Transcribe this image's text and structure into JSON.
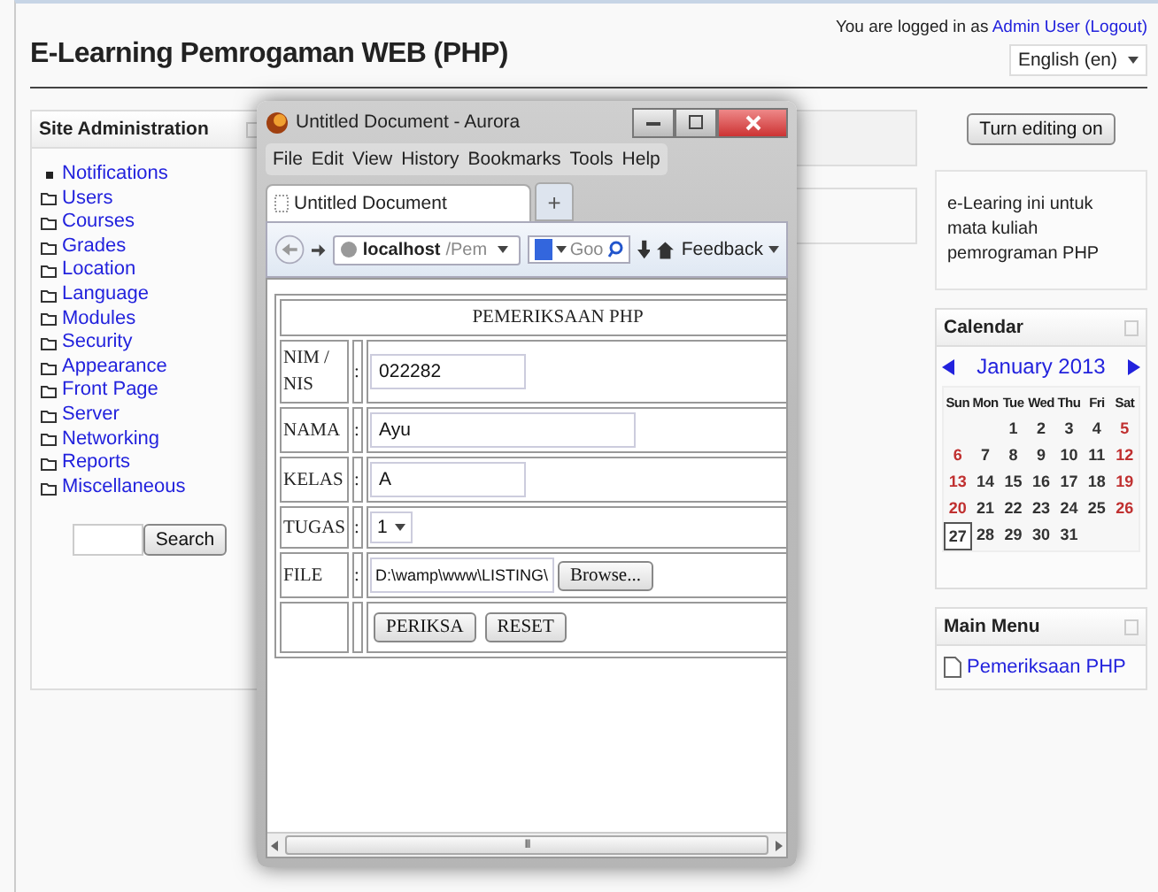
{
  "header": {
    "title": "E-Learning Pemrogaman WEB (PHP)",
    "login_prefix": "You are logged in as",
    "user": "Admin User",
    "logout": "(Logout)",
    "language": "English (en)"
  },
  "site_admin": {
    "title": "Site Administration",
    "items": [
      {
        "label": "Notifications",
        "kind": "bullet"
      },
      {
        "label": "Users",
        "kind": "folder"
      },
      {
        "label": "Courses",
        "kind": "folder"
      },
      {
        "label": "Grades",
        "kind": "folder"
      },
      {
        "label": "Location",
        "kind": "folder"
      },
      {
        "label": "Language",
        "kind": "folder"
      },
      {
        "label": "Modules",
        "kind": "folder"
      },
      {
        "label": "Security",
        "kind": "folder"
      },
      {
        "label": "Appearance",
        "kind": "folder"
      },
      {
        "label": "Front Page",
        "kind": "folder"
      },
      {
        "label": "Server",
        "kind": "folder"
      },
      {
        "label": "Networking",
        "kind": "folder"
      },
      {
        "label": "Reports",
        "kind": "folder"
      },
      {
        "label": "Miscellaneous",
        "kind": "folder"
      }
    ],
    "search_button": "Search"
  },
  "browser": {
    "title": "Untitled Document - Aurora",
    "menu": [
      "File",
      "Edit",
      "View",
      "History",
      "Bookmarks",
      "Tools",
      "Help"
    ],
    "tab": "Untitled Document",
    "new_tab": "+",
    "url_host": "localhost",
    "url_path": "/Pem",
    "search": "Goo",
    "feedback": "Feedback",
    "form": {
      "heading": "PEMERIKSAAN PHP",
      "rows": [
        {
          "label": "NIM / NIS",
          "sep": ":",
          "kind": "text",
          "value": "022282"
        },
        {
          "label": "NAMA",
          "sep": ":",
          "kind": "wide",
          "value": "Ayu"
        },
        {
          "label": "KELAS",
          "sep": ":",
          "kind": "text",
          "value": "A"
        },
        {
          "label": "TUGAS",
          "sep": ":",
          "kind": "select",
          "value": "1"
        },
        {
          "label": "FILE",
          "sep": ":",
          "kind": "file",
          "value": "D:\\wamp\\www\\LISTING\\",
          "button": "Browse..."
        }
      ],
      "buttons": [
        "PERIKSA",
        "RESET"
      ]
    },
    "scroll_mark": "III"
  },
  "right": {
    "editing_button": "Turn editing on",
    "info": "e-Learing ini untuk mata kuliah pemrograman PHP",
    "calendar": {
      "title": "Calendar",
      "month": "January 2013",
      "weekdays": [
        "Sun",
        "Mon",
        "Tue",
        "Wed",
        "Thu",
        "Fri",
        "Sat"
      ],
      "weeks": [
        [
          {
            "kind": "blank"
          },
          {
            "kind": "blank"
          },
          {
            "kind": "day",
            "day": "1",
            "weekend": false,
            "today": false
          },
          {
            "day": "2",
            "weekend": false,
            "today": false
          },
          {
            "day": "3",
            "weekend": false,
            "today": false
          },
          {
            "day": "4",
            "weekend": false,
            "today": false
          },
          {
            "day": "5",
            "weekend": true,
            "today": false
          }
        ],
        [
          {
            "day": "6",
            "weekend": true,
            "today": false
          },
          {
            "day": "7",
            "weekend": false,
            "today": false
          },
          {
            "day": "8",
            "weekend": false,
            "today": false
          },
          {
            "day": "9",
            "weekend": false,
            "today": false
          },
          {
            "day": "10",
            "weekend": false,
            "today": false
          },
          {
            "day": "11",
            "weekend": false,
            "today": false
          },
          {
            "day": "12",
            "weekend": true,
            "today": false
          }
        ],
        [
          {
            "day": "13",
            "weekend": true,
            "today": false
          },
          {
            "day": "14",
            "weekend": false,
            "today": false
          },
          {
            "day": "15",
            "weekend": false,
            "today": false
          },
          {
            "day": "16",
            "weekend": false,
            "today": false
          },
          {
            "day": "17",
            "weekend": false,
            "today": false
          },
          {
            "day": "18",
            "weekend": false,
            "today": false
          },
          {
            "day": "19",
            "weekend": true,
            "today": false
          }
        ],
        [
          {
            "day": "20",
            "weekend": true,
            "today": false
          },
          {
            "day": "21",
            "weekend": false,
            "today": false
          },
          {
            "day": "22",
            "weekend": false,
            "today": false
          },
          {
            "day": "23",
            "weekend": false,
            "today": false
          },
          {
            "day": "24",
            "weekend": false,
            "today": false
          },
          {
            "day": "25",
            "weekend": false,
            "today": false
          },
          {
            "day": "26",
            "weekend": true,
            "today": false
          }
        ],
        [
          {
            "day": "27",
            "weekend": false,
            "today": true
          },
          {
            "day": "28",
            "weekend": false,
            "today": false
          },
          {
            "day": "29",
            "weekend": false,
            "today": false
          },
          {
            "day": "30",
            "weekend": false,
            "today": false
          },
          {
            "day": "31",
            "weekend": false,
            "today": false
          },
          {
            "kind": "blank"
          },
          {
            "kind": "blank"
          }
        ]
      ]
    },
    "main_menu": {
      "title": "Main Menu",
      "items": [
        "Pemeriksaan PHP"
      ]
    }
  }
}
